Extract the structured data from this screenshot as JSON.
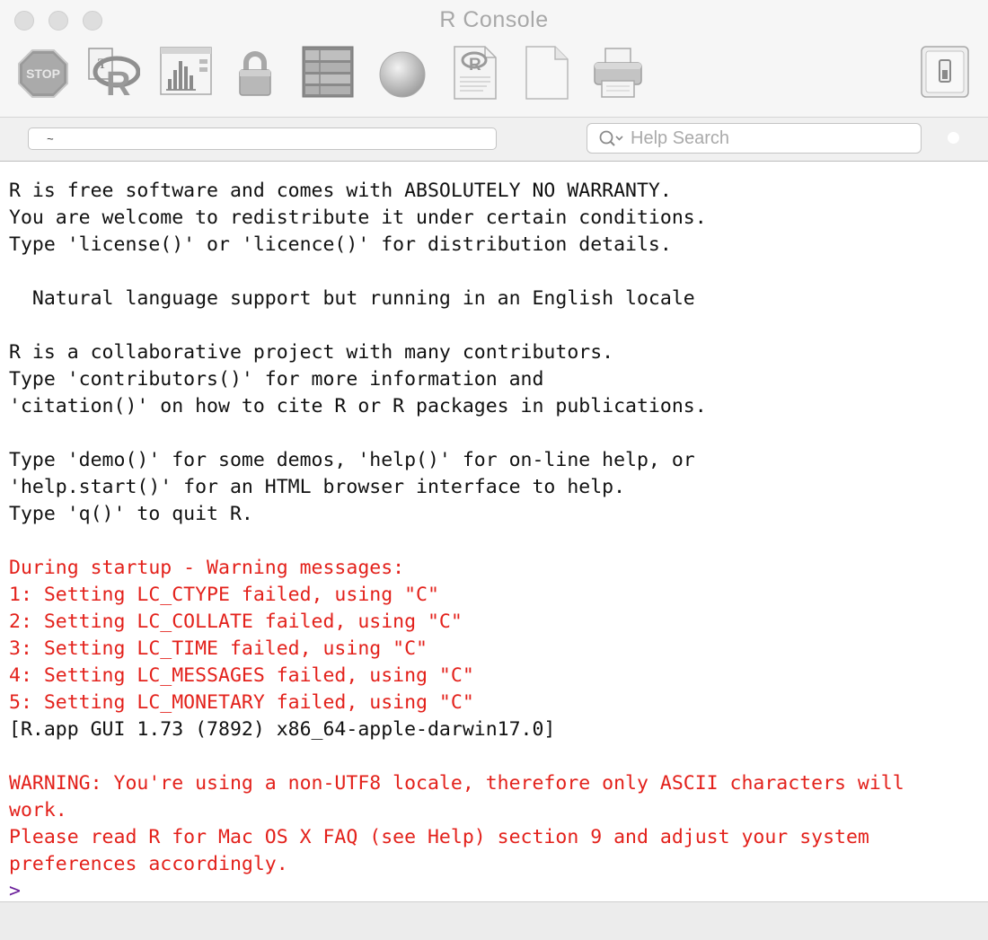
{
  "window": {
    "title": "R Console"
  },
  "toolbar": {
    "items": [
      {
        "name": "stop",
        "icon": "stop-icon"
      },
      {
        "name": "source-script",
        "icon": "source-r-icon"
      },
      {
        "name": "quartz",
        "icon": "quartz-chart-icon"
      },
      {
        "name": "lock",
        "icon": "lock-icon"
      },
      {
        "name": "show-workspace",
        "icon": "workspace-list-icon"
      },
      {
        "name": "color",
        "icon": "sphere-icon"
      },
      {
        "name": "open-document",
        "icon": "r-document-icon"
      },
      {
        "name": "new-document",
        "icon": "blank-document-icon"
      },
      {
        "name": "print",
        "icon": "printer-icon"
      },
      {
        "name": "toggle-drawer",
        "icon": "drawer-toggle-icon"
      }
    ]
  },
  "path_bar": {
    "value": "~"
  },
  "help_search": {
    "placeholder": "Help Search"
  },
  "console": {
    "lines": [
      {
        "text": "R is free software and comes with ABSOLUTELY NO WARRANTY.",
        "style": "normal"
      },
      {
        "text": "You are welcome to redistribute it under certain conditions.",
        "style": "normal"
      },
      {
        "text": "Type 'license()' or 'licence()' for distribution details.",
        "style": "normal"
      },
      {
        "text": "",
        "style": "normal"
      },
      {
        "text": "  Natural language support but running in an English locale",
        "style": "normal"
      },
      {
        "text": "",
        "style": "normal"
      },
      {
        "text": "R is a collaborative project with many contributors.",
        "style": "normal"
      },
      {
        "text": "Type 'contributors()' for more information and",
        "style": "normal"
      },
      {
        "text": "'citation()' on how to cite R or R packages in publications.",
        "style": "normal"
      },
      {
        "text": "",
        "style": "normal"
      },
      {
        "text": "Type 'demo()' for some demos, 'help()' for on-line help, or",
        "style": "normal"
      },
      {
        "text": "'help.start()' for an HTML browser interface to help.",
        "style": "normal"
      },
      {
        "text": "Type 'q()' to quit R.",
        "style": "normal"
      },
      {
        "text": "",
        "style": "normal"
      },
      {
        "text": "During startup - Warning messages:",
        "style": "error"
      },
      {
        "text": "1: Setting LC_CTYPE failed, using \"C\"",
        "style": "error"
      },
      {
        "text": "2: Setting LC_COLLATE failed, using \"C\"",
        "style": "error"
      },
      {
        "text": "3: Setting LC_TIME failed, using \"C\"",
        "style": "error"
      },
      {
        "text": "4: Setting LC_MESSAGES failed, using \"C\"",
        "style": "error"
      },
      {
        "text": "5: Setting LC_MONETARY failed, using \"C\"",
        "style": "error"
      },
      {
        "text": "[R.app GUI 1.73 (7892) x86_64-apple-darwin17.0]",
        "style": "normal"
      },
      {
        "text": "",
        "style": "normal"
      },
      {
        "text": "WARNING: You're using a non-UTF8 locale, therefore only ASCII characters will",
        "style": "error"
      },
      {
        "text": "work.",
        "style": "error"
      },
      {
        "text": "Please read R for Mac OS X FAQ (see Help) section 9 and adjust your system",
        "style": "error"
      },
      {
        "text": "preferences accordingly.",
        "style": "error"
      }
    ],
    "prompt": ">"
  },
  "colors": {
    "error_text": "#e3211b",
    "prompt": "#6a1e9a",
    "normal_text": "#111111"
  }
}
